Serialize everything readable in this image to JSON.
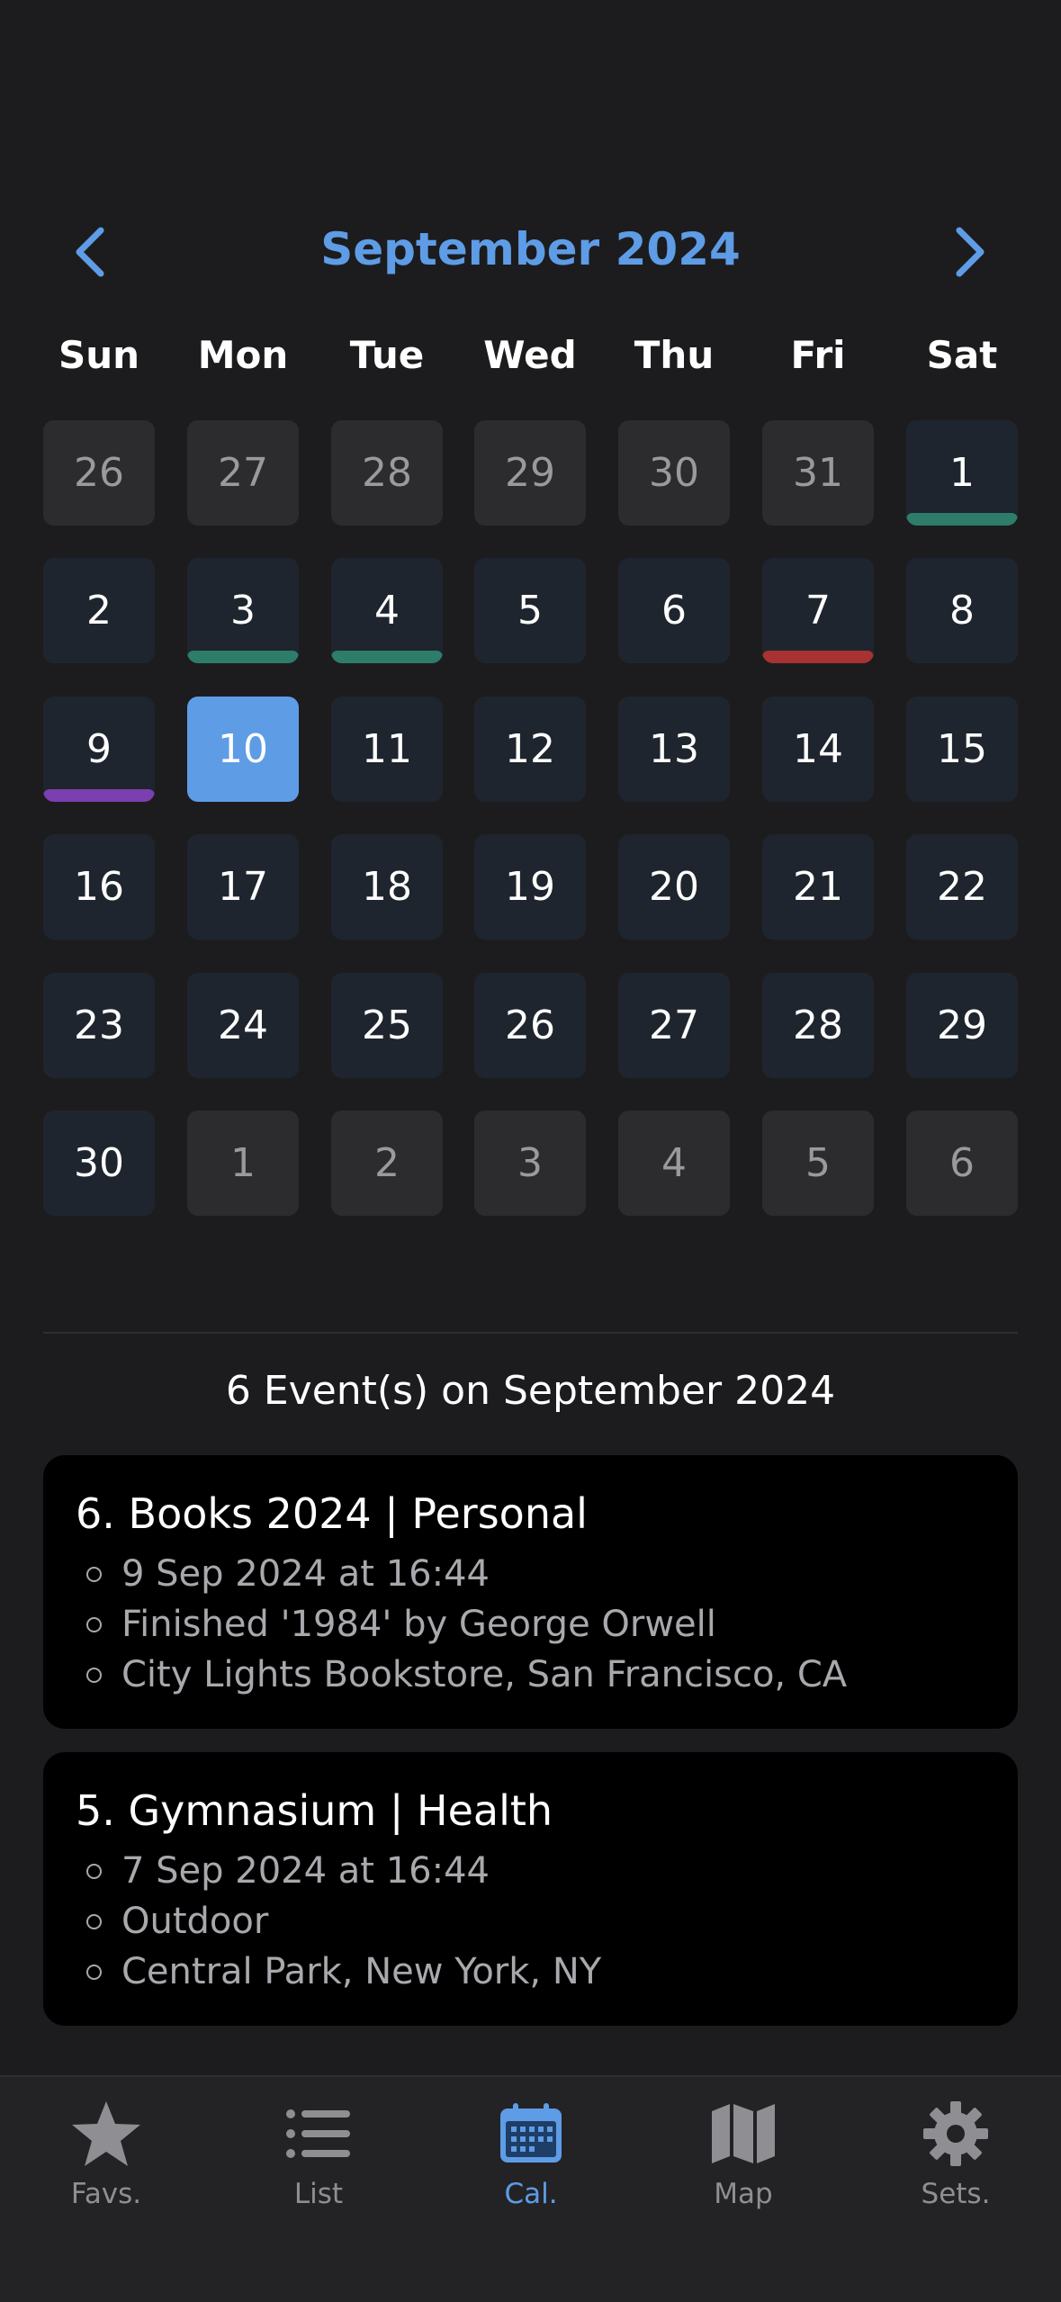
{
  "calendar": {
    "month_title": "September 2024",
    "weekdays": [
      "Sun",
      "Mon",
      "Tue",
      "Wed",
      "Thu",
      "Fri",
      "Sat"
    ],
    "days": [
      {
        "label": "26",
        "in_month": false
      },
      {
        "label": "27",
        "in_month": false
      },
      {
        "label": "28",
        "in_month": false
      },
      {
        "label": "29",
        "in_month": false
      },
      {
        "label": "30",
        "in_month": false
      },
      {
        "label": "31",
        "in_month": false
      },
      {
        "label": "1",
        "in_month": true,
        "marker": "#2e7d6b"
      },
      {
        "label": "2",
        "in_month": true
      },
      {
        "label": "3",
        "in_month": true,
        "marker": "#2e7d6b"
      },
      {
        "label": "4",
        "in_month": true,
        "marker": "#2e7d6b"
      },
      {
        "label": "5",
        "in_month": true
      },
      {
        "label": "6",
        "in_month": true
      },
      {
        "label": "7",
        "in_month": true,
        "marker": "#a83232"
      },
      {
        "label": "8",
        "in_month": true
      },
      {
        "label": "9",
        "in_month": true,
        "marker": "#7b3fb0"
      },
      {
        "label": "10",
        "in_month": true,
        "selected": true
      },
      {
        "label": "11",
        "in_month": true
      },
      {
        "label": "12",
        "in_month": true
      },
      {
        "label": "13",
        "in_month": true
      },
      {
        "label": "14",
        "in_month": true
      },
      {
        "label": "15",
        "in_month": true
      },
      {
        "label": "16",
        "in_month": true
      },
      {
        "label": "17",
        "in_month": true
      },
      {
        "label": "18",
        "in_month": true
      },
      {
        "label": "19",
        "in_month": true
      },
      {
        "label": "20",
        "in_month": true
      },
      {
        "label": "21",
        "in_month": true
      },
      {
        "label": "22",
        "in_month": true
      },
      {
        "label": "23",
        "in_month": true
      },
      {
        "label": "24",
        "in_month": true
      },
      {
        "label": "25",
        "in_month": true
      },
      {
        "label": "26",
        "in_month": true
      },
      {
        "label": "27",
        "in_month": true
      },
      {
        "label": "28",
        "in_month": true
      },
      {
        "label": "29",
        "in_month": true
      },
      {
        "label": "30",
        "in_month": true
      },
      {
        "label": "1",
        "in_month": false
      },
      {
        "label": "2",
        "in_month": false
      },
      {
        "label": "3",
        "in_month": false
      },
      {
        "label": "4",
        "in_month": false
      },
      {
        "label": "5",
        "in_month": false
      },
      {
        "label": "6",
        "in_month": false
      }
    ]
  },
  "events": {
    "heading": "6 Event(s) on September 2024",
    "items": [
      {
        "title": "6. Books 2024 | Personal",
        "lines": [
          "9 Sep 2024 at 16:44",
          "Finished '1984' by George Orwell",
          "City Lights Bookstore, San Francisco, CA"
        ]
      },
      {
        "title": "5. Gymnasium | Health",
        "lines": [
          "7 Sep 2024 at 16:44",
          "Outdoor",
          "Central Park, New York, NY"
        ]
      }
    ]
  },
  "tabbar": {
    "tabs": [
      {
        "label": "Favs.",
        "icon": "star-icon"
      },
      {
        "label": "List",
        "icon": "list-icon"
      },
      {
        "label": "Cal.",
        "icon": "calendar-icon",
        "active": true
      },
      {
        "label": "Map",
        "icon": "map-icon"
      },
      {
        "label": "Sets.",
        "icon": "gear-icon"
      }
    ]
  },
  "colors": {
    "accent": "#5e9ce6",
    "background": "#1c1c1e",
    "card": "#000000",
    "day_in_month": "#1f252e",
    "day_out_month": "#2c2c2e"
  }
}
